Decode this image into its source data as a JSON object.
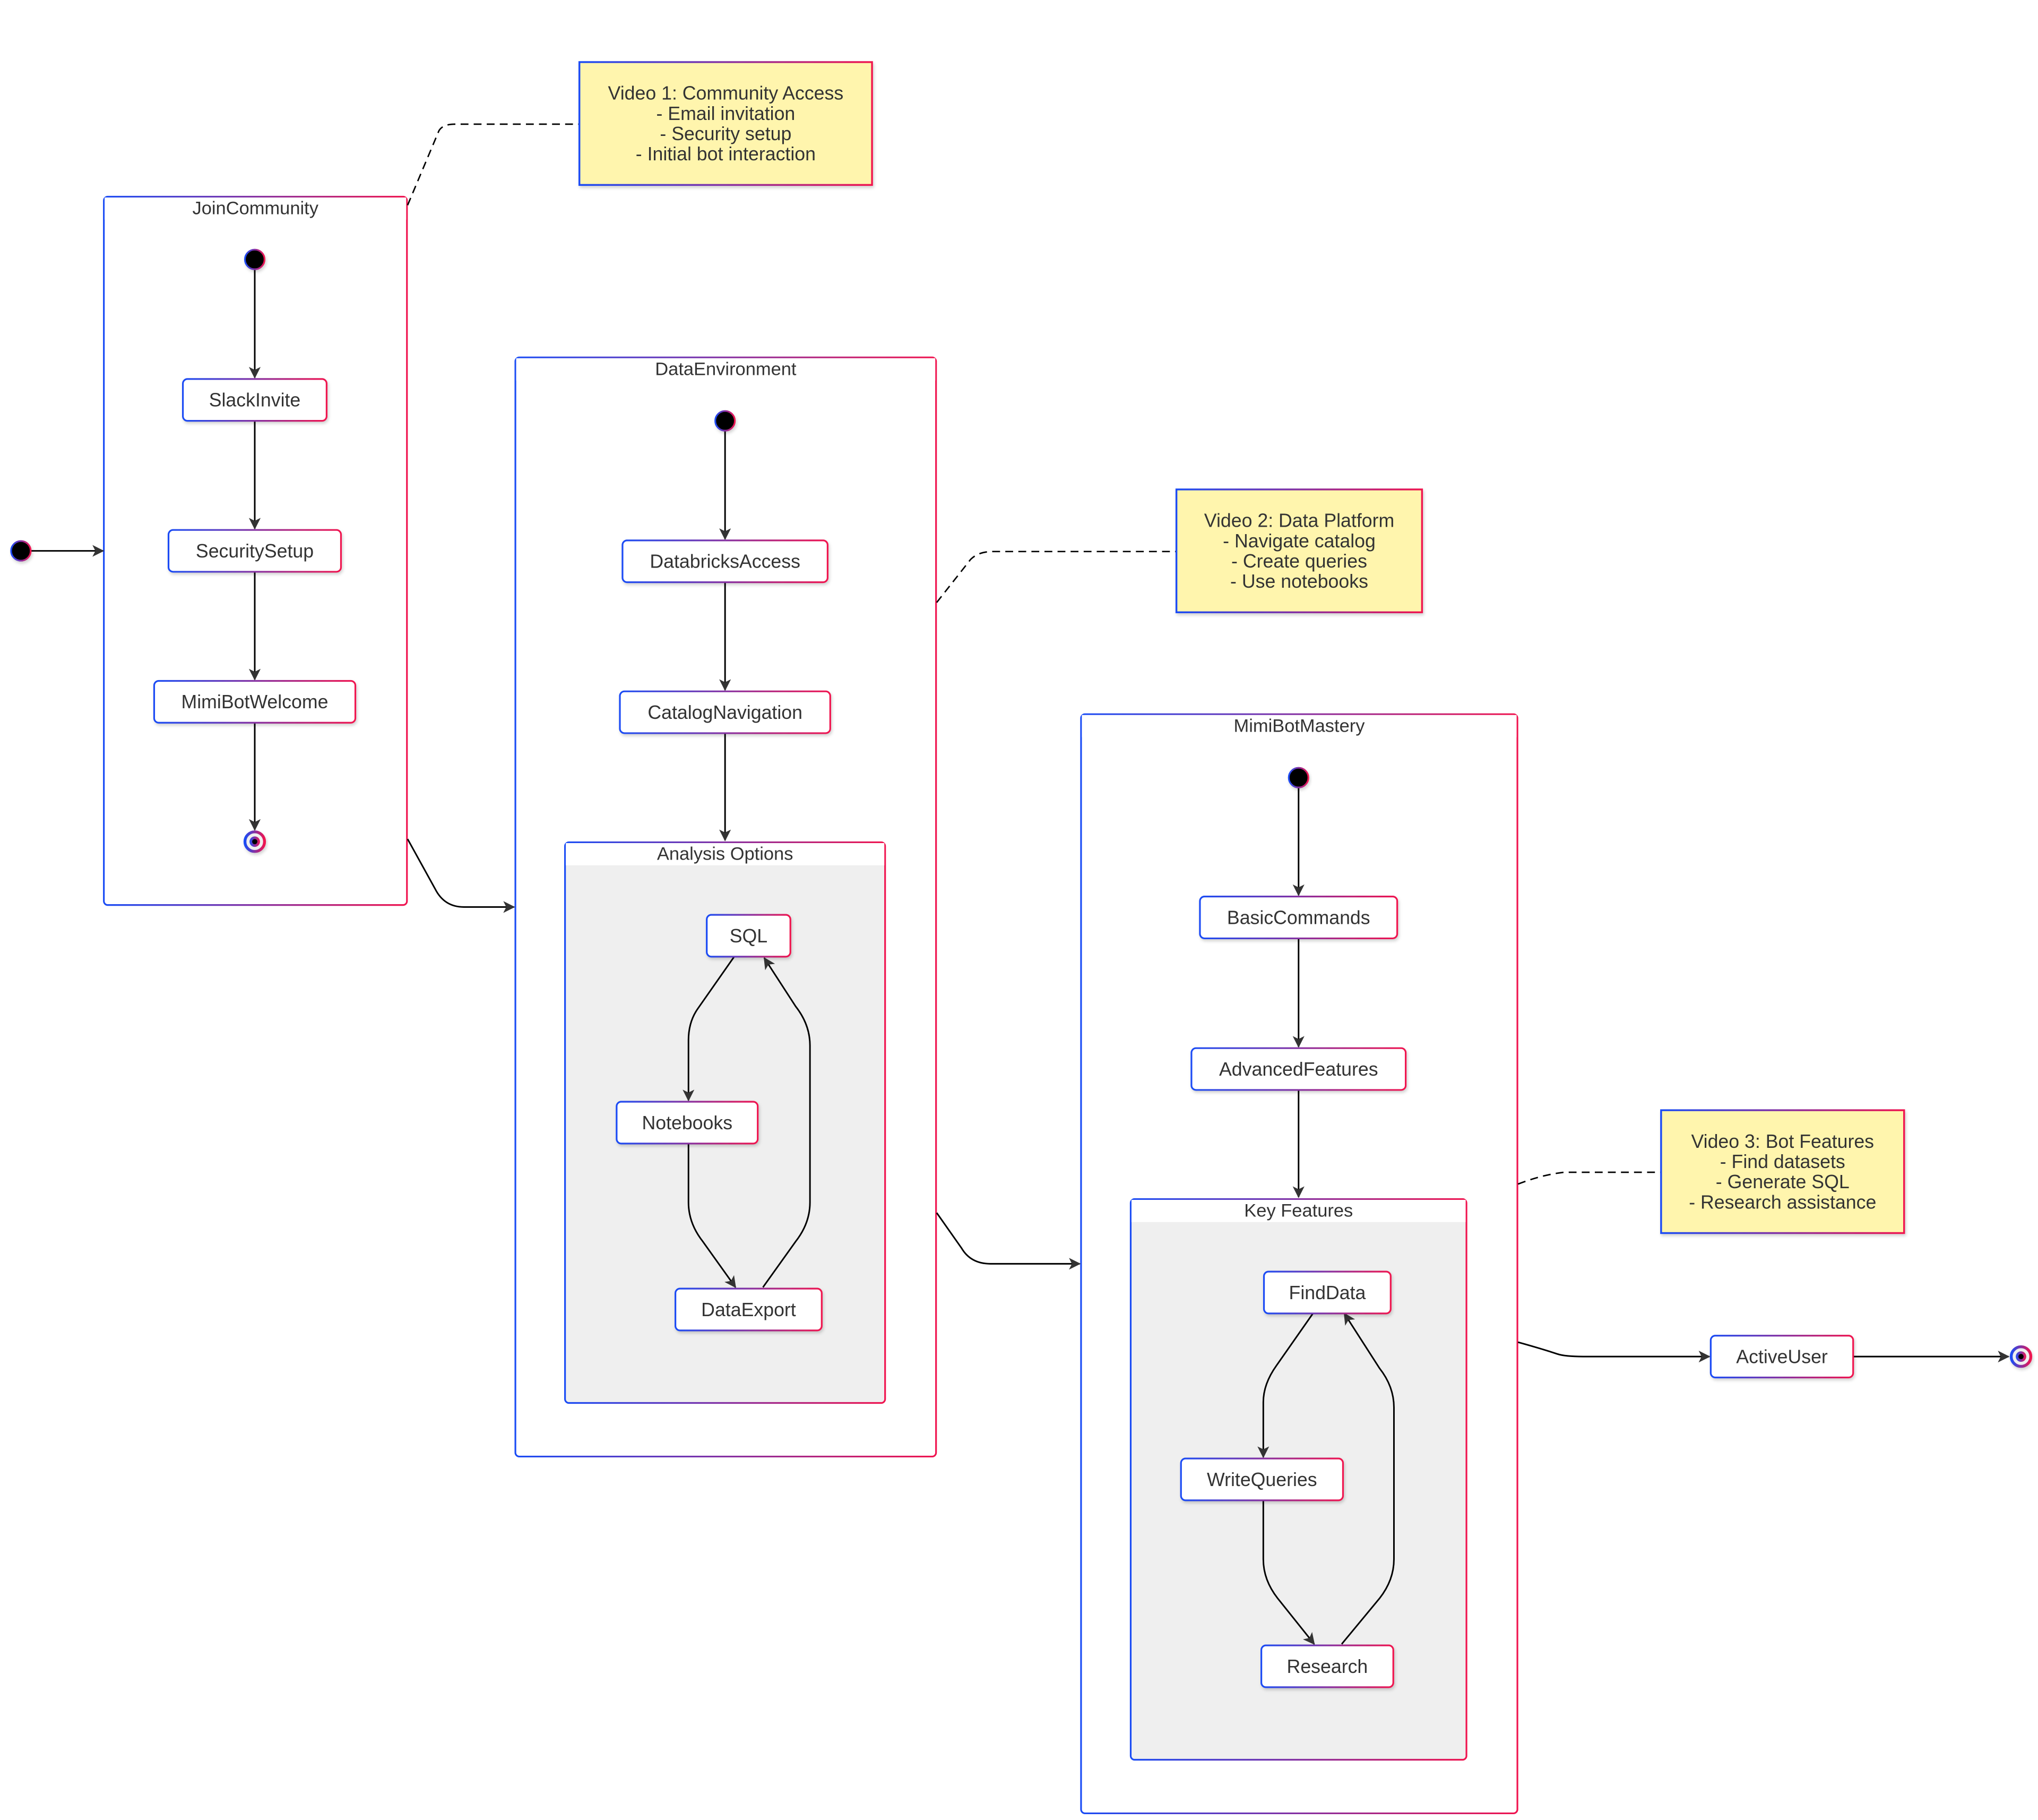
{
  "diagram": {
    "type": "state-diagram",
    "colors": {
      "gradient_start": "#1a4cf5",
      "gradient_end": "#f0144f",
      "note_fill": "#fff5ad",
      "composite_inner_fill": "#efefef",
      "text": "#333333",
      "edge": "#000000",
      "arrowhead": "#333333"
    },
    "composites": [
      {
        "id": "JoinCommunity",
        "label": "JoinCommunity",
        "states": [
          "SlackInvite",
          "SecuritySetup",
          "MimiBotWelcome"
        ],
        "has_initial": true,
        "has_final": true
      },
      {
        "id": "DataEnvironment",
        "label": "DataEnvironment",
        "states": [
          "DatabricksAccess",
          "CatalogNavigation"
        ],
        "has_initial": true,
        "has_final": false
      },
      {
        "id": "AnalysisOptions",
        "label": "Analysis Options",
        "parent": "DataEnvironment",
        "states": [
          "SQL",
          "Notebooks",
          "DataExport"
        ]
      },
      {
        "id": "MimiBotMastery",
        "label": "MimiBotMastery",
        "states": [
          "BasicCommands",
          "AdvancedFeatures"
        ],
        "has_initial": true,
        "has_final": false
      },
      {
        "id": "KeyFeatures",
        "label": "Key Features",
        "parent": "MimiBotMastery",
        "states": [
          "FindData",
          "WriteQueries",
          "Research"
        ]
      }
    ],
    "states": [
      {
        "id": "SlackInvite",
        "label": "SlackInvite"
      },
      {
        "id": "SecuritySetup",
        "label": "SecuritySetup"
      },
      {
        "id": "MimiBotWelcome",
        "label": "MimiBotWelcome"
      },
      {
        "id": "DatabricksAccess",
        "label": "DatabricksAccess"
      },
      {
        "id": "CatalogNavigation",
        "label": "CatalogNavigation"
      },
      {
        "id": "SQL",
        "label": "SQL"
      },
      {
        "id": "Notebooks",
        "label": "Notebooks"
      },
      {
        "id": "DataExport",
        "label": "DataExport"
      },
      {
        "id": "BasicCommands",
        "label": "BasicCommands"
      },
      {
        "id": "AdvancedFeatures",
        "label": "AdvancedFeatures"
      },
      {
        "id": "FindData",
        "label": "FindData"
      },
      {
        "id": "WriteQueries",
        "label": "WriteQueries"
      },
      {
        "id": "Research",
        "label": "Research"
      },
      {
        "id": "ActiveUser",
        "label": "ActiveUser"
      }
    ],
    "transitions": [
      {
        "from": "[*]",
        "to": "JoinCommunity"
      },
      {
        "from": "JoinCommunity.[*]",
        "to": "SlackInvite"
      },
      {
        "from": "SlackInvite",
        "to": "SecuritySetup"
      },
      {
        "from": "SecuritySetup",
        "to": "MimiBotWelcome"
      },
      {
        "from": "MimiBotWelcome",
        "to": "JoinCommunity.[*]end"
      },
      {
        "from": "JoinCommunity",
        "to": "DataEnvironment"
      },
      {
        "from": "DataEnvironment.[*]",
        "to": "DatabricksAccess"
      },
      {
        "from": "DatabricksAccess",
        "to": "CatalogNavigation"
      },
      {
        "from": "CatalogNavigation",
        "to": "AnalysisOptions"
      },
      {
        "from": "SQL",
        "to": "Notebooks"
      },
      {
        "from": "Notebooks",
        "to": "DataExport"
      },
      {
        "from": "DataExport",
        "to": "SQL"
      },
      {
        "from": "DataEnvironment",
        "to": "MimiBotMastery"
      },
      {
        "from": "MimiBotMastery.[*]",
        "to": "BasicCommands"
      },
      {
        "from": "BasicCommands",
        "to": "AdvancedFeatures"
      },
      {
        "from": "AdvancedFeatures",
        "to": "KeyFeatures"
      },
      {
        "from": "FindData",
        "to": "WriteQueries"
      },
      {
        "from": "WriteQueries",
        "to": "Research"
      },
      {
        "from": "Research",
        "to": "FindData"
      },
      {
        "from": "MimiBotMastery",
        "to": "ActiveUser"
      },
      {
        "from": "ActiveUser",
        "to": "[*]end"
      }
    ],
    "notes": [
      {
        "id": "note1",
        "attached_to": "JoinCommunity",
        "lines": [
          "Video 1: Community Access",
          "- Email invitation",
          "- Security setup",
          "- Initial bot interaction"
        ]
      },
      {
        "id": "note2",
        "attached_to": "DataEnvironment",
        "lines": [
          "Video 2: Data Platform",
          "- Navigate catalog",
          "- Create queries",
          "- Use notebooks"
        ]
      },
      {
        "id": "note3",
        "attached_to": "MimiBotMastery",
        "lines": [
          "Video 3: Bot Features",
          "- Find datasets",
          "- Generate SQL",
          "- Research assistance"
        ]
      }
    ]
  }
}
